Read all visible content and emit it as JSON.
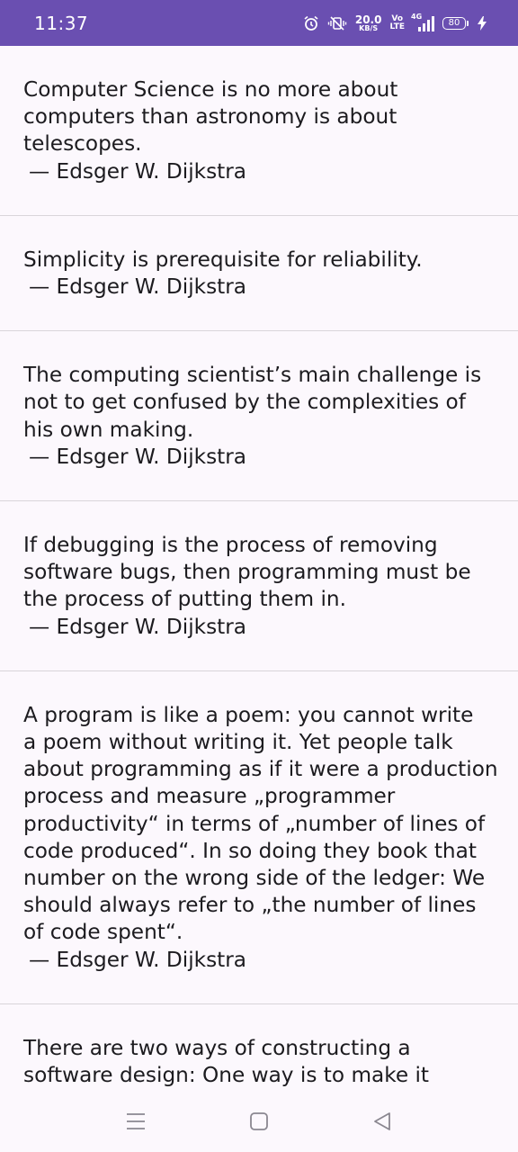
{
  "status_bar": {
    "time": "11:37",
    "net_speed_value": "20.0",
    "net_speed_unit": "KB/S",
    "volte_top": "Vo",
    "volte_bottom": "LTE",
    "network_type": "4G",
    "battery_level": "80",
    "icons": [
      "alarm-icon",
      "vibrate-icon",
      "signal-icon",
      "battery-icon",
      "charging-icon"
    ]
  },
  "quotes": [
    {
      "text": "Computer Science is no more about\ncomputers than astronomy is about\ntelescopes.",
      "author": "— Edsger W. Dijkstra"
    },
    {
      "text": "Simplicity is prerequisite for reliability.",
      "author": "— Edsger W. Dijkstra"
    },
    {
      "text": "The computing scientist’s main challenge is\nnot to get confused by the complexities of\nhis own making.",
      "author": "— Edsger W. Dijkstra"
    },
    {
      "text": "If debugging is the process of removing\nsoftware bugs, then programming must be\nthe process of putting them in.",
      "author": "— Edsger W. Dijkstra"
    },
    {
      "text": "A program is like a poem: you cannot write\na poem without writing it. Yet people talk\nabout programming as if it were a production\nprocess and measure „programmer\nproductivity“ in terms of „number of lines of\ncode produced“. In so doing they book that\nnumber on the wrong side of the ledger: We\nshould always refer to „the number of lines\nof code spent“.",
      "author": "— Edsger W. Dijkstra"
    },
    {
      "text": "There are two ways of constructing a\nsoftware design: One way is to make it",
      "author": ""
    }
  ],
  "nav_bar": {
    "icons": [
      "menu-icon",
      "home-icon",
      "back-icon"
    ]
  },
  "colors": {
    "status_bar_bg": "#6a4fb1",
    "page_bg": "#fcf8fd",
    "text": "#1c1b1f",
    "divider": "#d9d5da"
  }
}
